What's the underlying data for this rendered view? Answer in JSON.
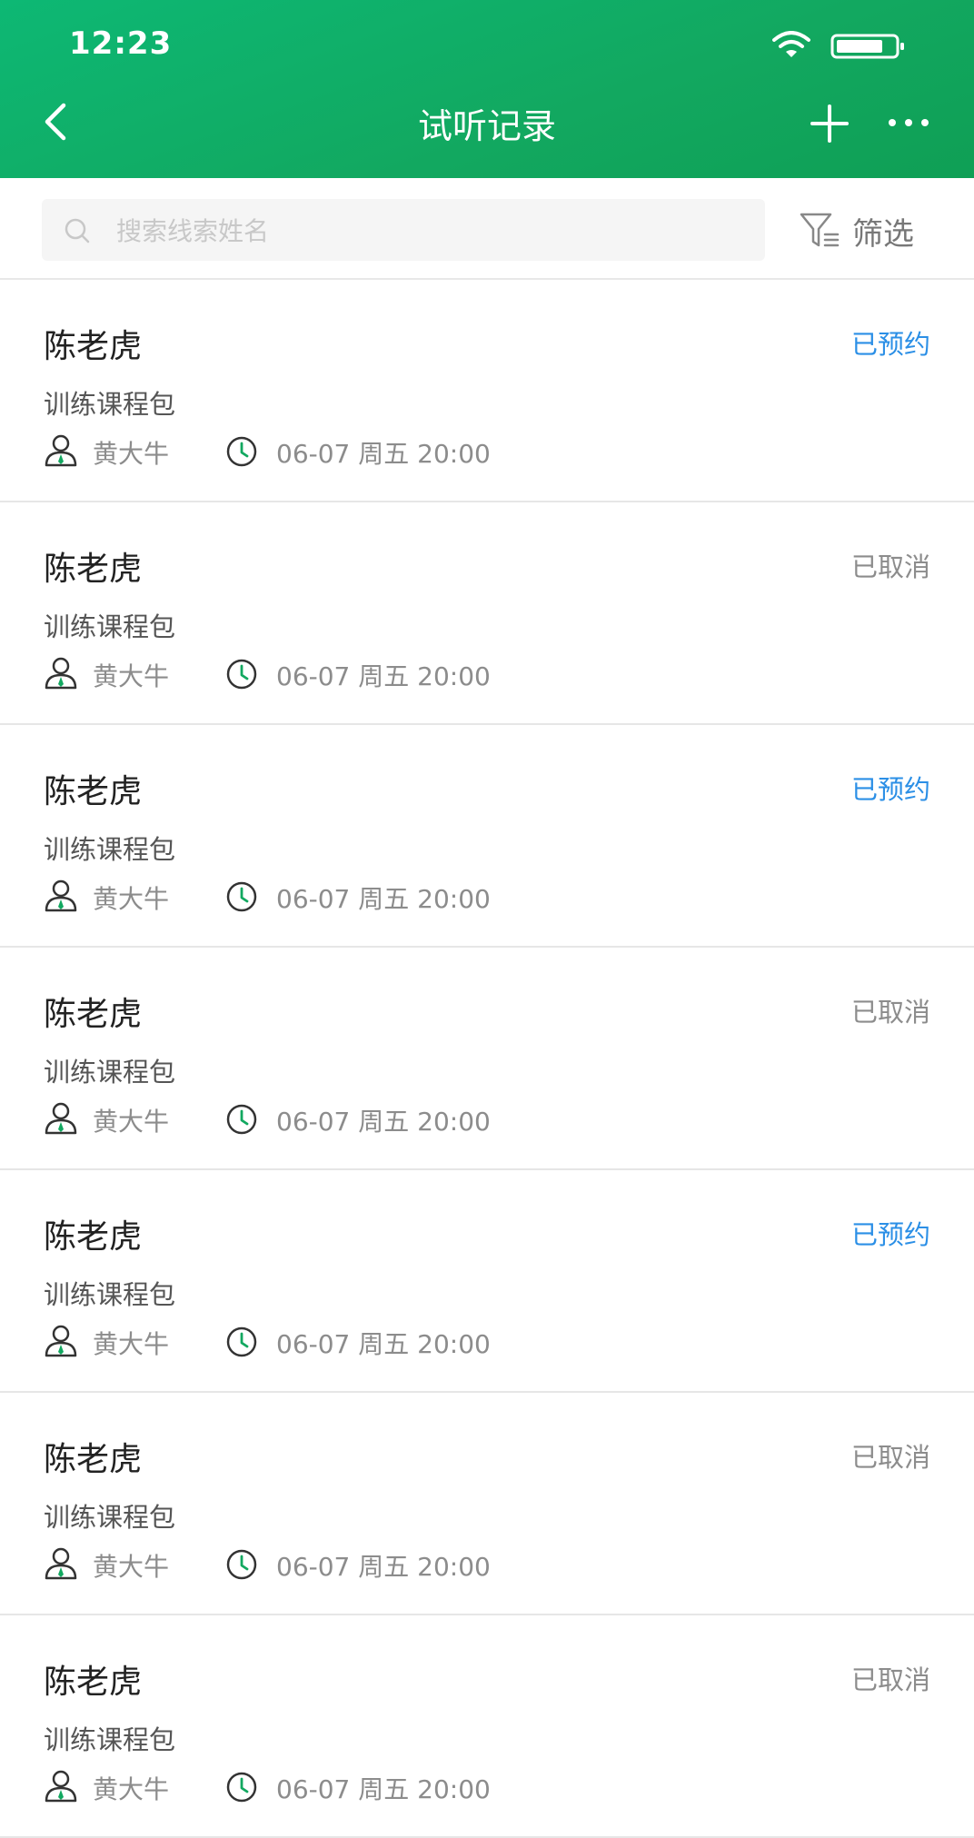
{
  "status_bar": {
    "time": "12:23"
  },
  "nav": {
    "title": "试听记录"
  },
  "search": {
    "placeholder": "搜索线索姓名",
    "value": ""
  },
  "filter": {
    "label": "筛选"
  },
  "colors": {
    "brand": "#12a860",
    "booked": "#2b8fe6",
    "cancelled": "#8c8c8c"
  },
  "records": [
    {
      "name": "陈老虎",
      "status": "已预约",
      "status_type": "booked",
      "course": "训练课程包",
      "teacher": "黄大牛",
      "time": "06-07 周五 20:00"
    },
    {
      "name": "陈老虎",
      "status": "已取消",
      "status_type": "cancelled",
      "course": "训练课程包",
      "teacher": "黄大牛",
      "time": "06-07 周五 20:00"
    },
    {
      "name": "陈老虎",
      "status": "已预约",
      "status_type": "booked",
      "course": "训练课程包",
      "teacher": "黄大牛",
      "time": "06-07 周五 20:00"
    },
    {
      "name": "陈老虎",
      "status": "已取消",
      "status_type": "cancelled",
      "course": "训练课程包",
      "teacher": "黄大牛",
      "time": "06-07 周五 20:00"
    },
    {
      "name": "陈老虎",
      "status": "已预约",
      "status_type": "booked",
      "course": "训练课程包",
      "teacher": "黄大牛",
      "time": "06-07 周五 20:00"
    },
    {
      "name": "陈老虎",
      "status": "已取消",
      "status_type": "cancelled",
      "course": "训练课程包",
      "teacher": "黄大牛",
      "time": "06-07 周五 20:00"
    },
    {
      "name": "陈老虎",
      "status": "已取消",
      "status_type": "cancelled",
      "course": "训练课程包",
      "teacher": "黄大牛",
      "time": "06-07 周五 20:00"
    }
  ]
}
